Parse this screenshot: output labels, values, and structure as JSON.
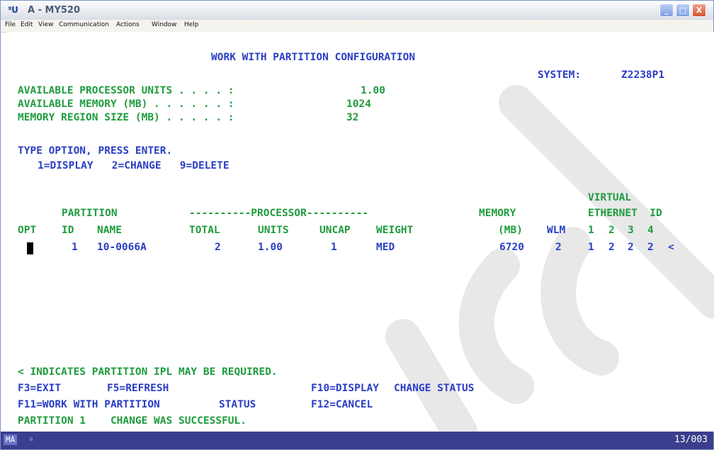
{
  "window": {
    "app_icon": "ᴲ𝗨",
    "title": "A - MY520",
    "buttons": {
      "minimize": "_",
      "maximize": "□",
      "close": "X"
    }
  },
  "menubar": {
    "items": [
      "File",
      "Edit",
      "View",
      "Communication",
      "Actions",
      "Window",
      "Help"
    ]
  },
  "terminal": {
    "screen_title": "WORK WITH PARTITION CONFIGURATION",
    "system_label": "SYSTEM:",
    "system_value": "Z2238P1",
    "fields": [
      {
        "label": "AVAILABLE PROCESSOR UNITS . . . . :",
        "value": "1.00"
      },
      {
        "label": "AVAILABLE MEMORY (MB) . . . . . . :",
        "value": "1024"
      },
      {
        "label": "MEMORY REGION SIZE (MB) . . . . . :",
        "value": "32"
      }
    ],
    "instructions": "TYPE OPTION, PRESS ENTER.",
    "options": "1=DISPLAY   2=CHANGE   9=DELETE",
    "headers": {
      "virtual": "VIRTUAL",
      "partition": "PARTITION",
      "processor": "----------PROCESSOR----------",
      "memory": "MEMORY",
      "ethernet_id": "ETHERNET  ID",
      "opt": "OPT",
      "id": "ID",
      "name": "NAME",
      "total": "TOTAL",
      "units": "UNITS",
      "uncap": "UNCAP",
      "weight": "WEIGHT",
      "mb": "(MB)",
      "wlm": "WLM",
      "eth1": "1",
      "eth2": "2",
      "eth3": "3",
      "eth4": "4"
    },
    "rows": [
      {
        "opt": "",
        "id": "1",
        "name": "10-0066A",
        "total": "2",
        "units": "1.00",
        "uncap": "1",
        "weight": "MED",
        "memory": "6720",
        "wlm": "2",
        "eth1": "1",
        "eth2": "2",
        "eth3": "2",
        "eth4": "2",
        "ipl_flag": "<"
      }
    ],
    "footer": {
      "note": "< INDICATES PARTITION IPL MAY BE REQUIRED.",
      "f3": "F3=EXIT",
      "f5": "F5=REFRESH",
      "f10": "F10=DISPLAY",
      "f10_rest": "CHANGE STATUS",
      "f11": "F11=WORK WITH PARTITION",
      "f11_rest": "STATUS",
      "f12": "F12=CANCEL",
      "message": "PARTITION 1    CHANGE WAS SUCCESSFUL."
    }
  },
  "statusbar": {
    "mode": "MA",
    "indicator": "a",
    "cursor_pos": "13/003"
  },
  "colors": {
    "terminal_green": "#1f9c3e",
    "terminal_blue": "#2a3ec4",
    "statusbar": "#3b3e8c",
    "watermark": "#e8e8e8"
  }
}
